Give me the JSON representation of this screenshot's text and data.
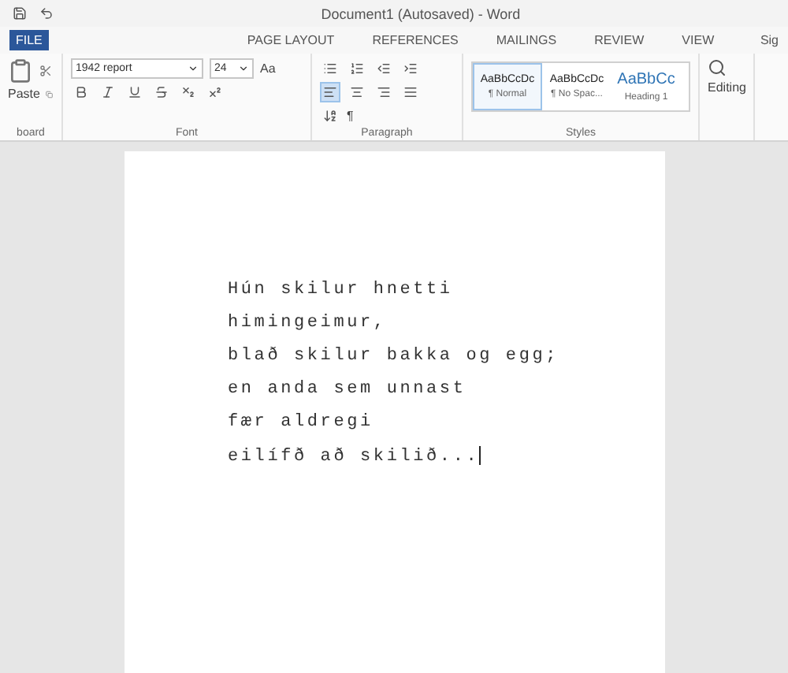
{
  "window": {
    "title": "Document1 (Autosaved) - Word",
    "account": "Sig"
  },
  "tabs": [
    {
      "label": "FILE",
      "kind": "file",
      "selected": false
    },
    {
      "label": "PAGE LAYOUT",
      "kind": "tab",
      "selected": false
    },
    {
      "label": "REFERENCES",
      "kind": "tab",
      "selected": false
    },
    {
      "label": "MAILINGS",
      "kind": "tab",
      "selected": false
    },
    {
      "label": "REVIEW",
      "kind": "tab",
      "selected": false
    },
    {
      "label": "VIEW",
      "kind": "tab",
      "selected": false
    }
  ],
  "clipboard": {
    "paste": "Paste",
    "label": "board"
  },
  "font": {
    "name": "1942 report",
    "size": "24",
    "case": "Aa",
    "label": "Font"
  },
  "paragraph": {
    "label": "Paragraph",
    "pilcrow": "¶",
    "alignments": [
      {
        "selected": true
      },
      {
        "selected": false
      },
      {
        "selected": false
      },
      {
        "selected": false
      }
    ]
  },
  "styles": {
    "label": "Styles",
    "items": [
      {
        "sample": "AaBbCcDc",
        "name": "¶ Normal",
        "kind": "body",
        "selected": true
      },
      {
        "sample": "AaBbCcDc",
        "name": "¶ No Spac...",
        "kind": "body",
        "selected": false
      },
      {
        "sample": "AaBbCc",
        "name": "Heading 1",
        "kind": "heading",
        "selected": false
      }
    ]
  },
  "editing": {
    "label": "Editing"
  },
  "document": {
    "lines": [
      "Hún skilur hnetti",
      "himingeimur,",
      "blað skilur bakka og egg;",
      "en anda sem unnast",
      "fær aldregi",
      "eilífð að skilið..."
    ]
  }
}
